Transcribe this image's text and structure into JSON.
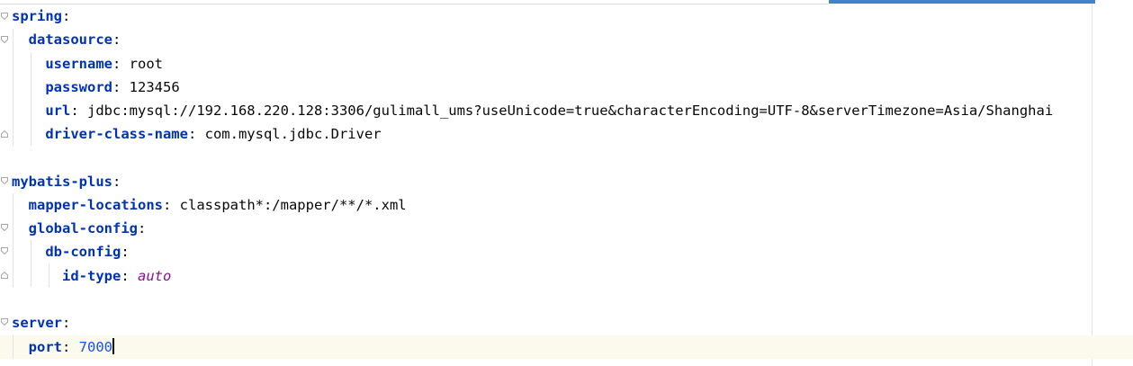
{
  "editor": {
    "file_type": "yaml",
    "colors": {
      "key": "#0033b3",
      "number": "#1750eb",
      "keyword_value": "#871094",
      "plain": "#080808",
      "caret_line": "#fcfaed",
      "tab_accent": "#4083c9"
    },
    "lines": [
      {
        "key": "spring",
        "colon": ":",
        "value": ""
      },
      {
        "key": "datasource",
        "colon": ":",
        "value": ""
      },
      {
        "key": "username",
        "colon": ":",
        "value": " root"
      },
      {
        "key": "password",
        "colon": ":",
        "value": " 123456"
      },
      {
        "key": "url",
        "colon": ":",
        "value": " jdbc:mysql://192.168.220.128:3306/gulimall_ums?useUnicode=true&characterEncoding=UTF-8&serverTimezone=Asia/Shanghai"
      },
      {
        "key": "driver-class-name",
        "colon": ":",
        "value": " com.mysql.jdbc.Driver"
      },
      {
        "key": "mybatis-plus",
        "colon": ":",
        "value": ""
      },
      {
        "key": "mapper-locations",
        "colon": ":",
        "value": " classpath*:/mapper/**/*.xml"
      },
      {
        "key": "global-config",
        "colon": ":",
        "value": ""
      },
      {
        "key": "db-config",
        "colon": ":",
        "value": ""
      },
      {
        "key": "id-type",
        "colon": ":",
        "value": " auto"
      },
      {
        "key": "server",
        "colon": ":",
        "value": ""
      },
      {
        "key": "port",
        "colon": ":",
        "value": " 7000"
      }
    ]
  }
}
